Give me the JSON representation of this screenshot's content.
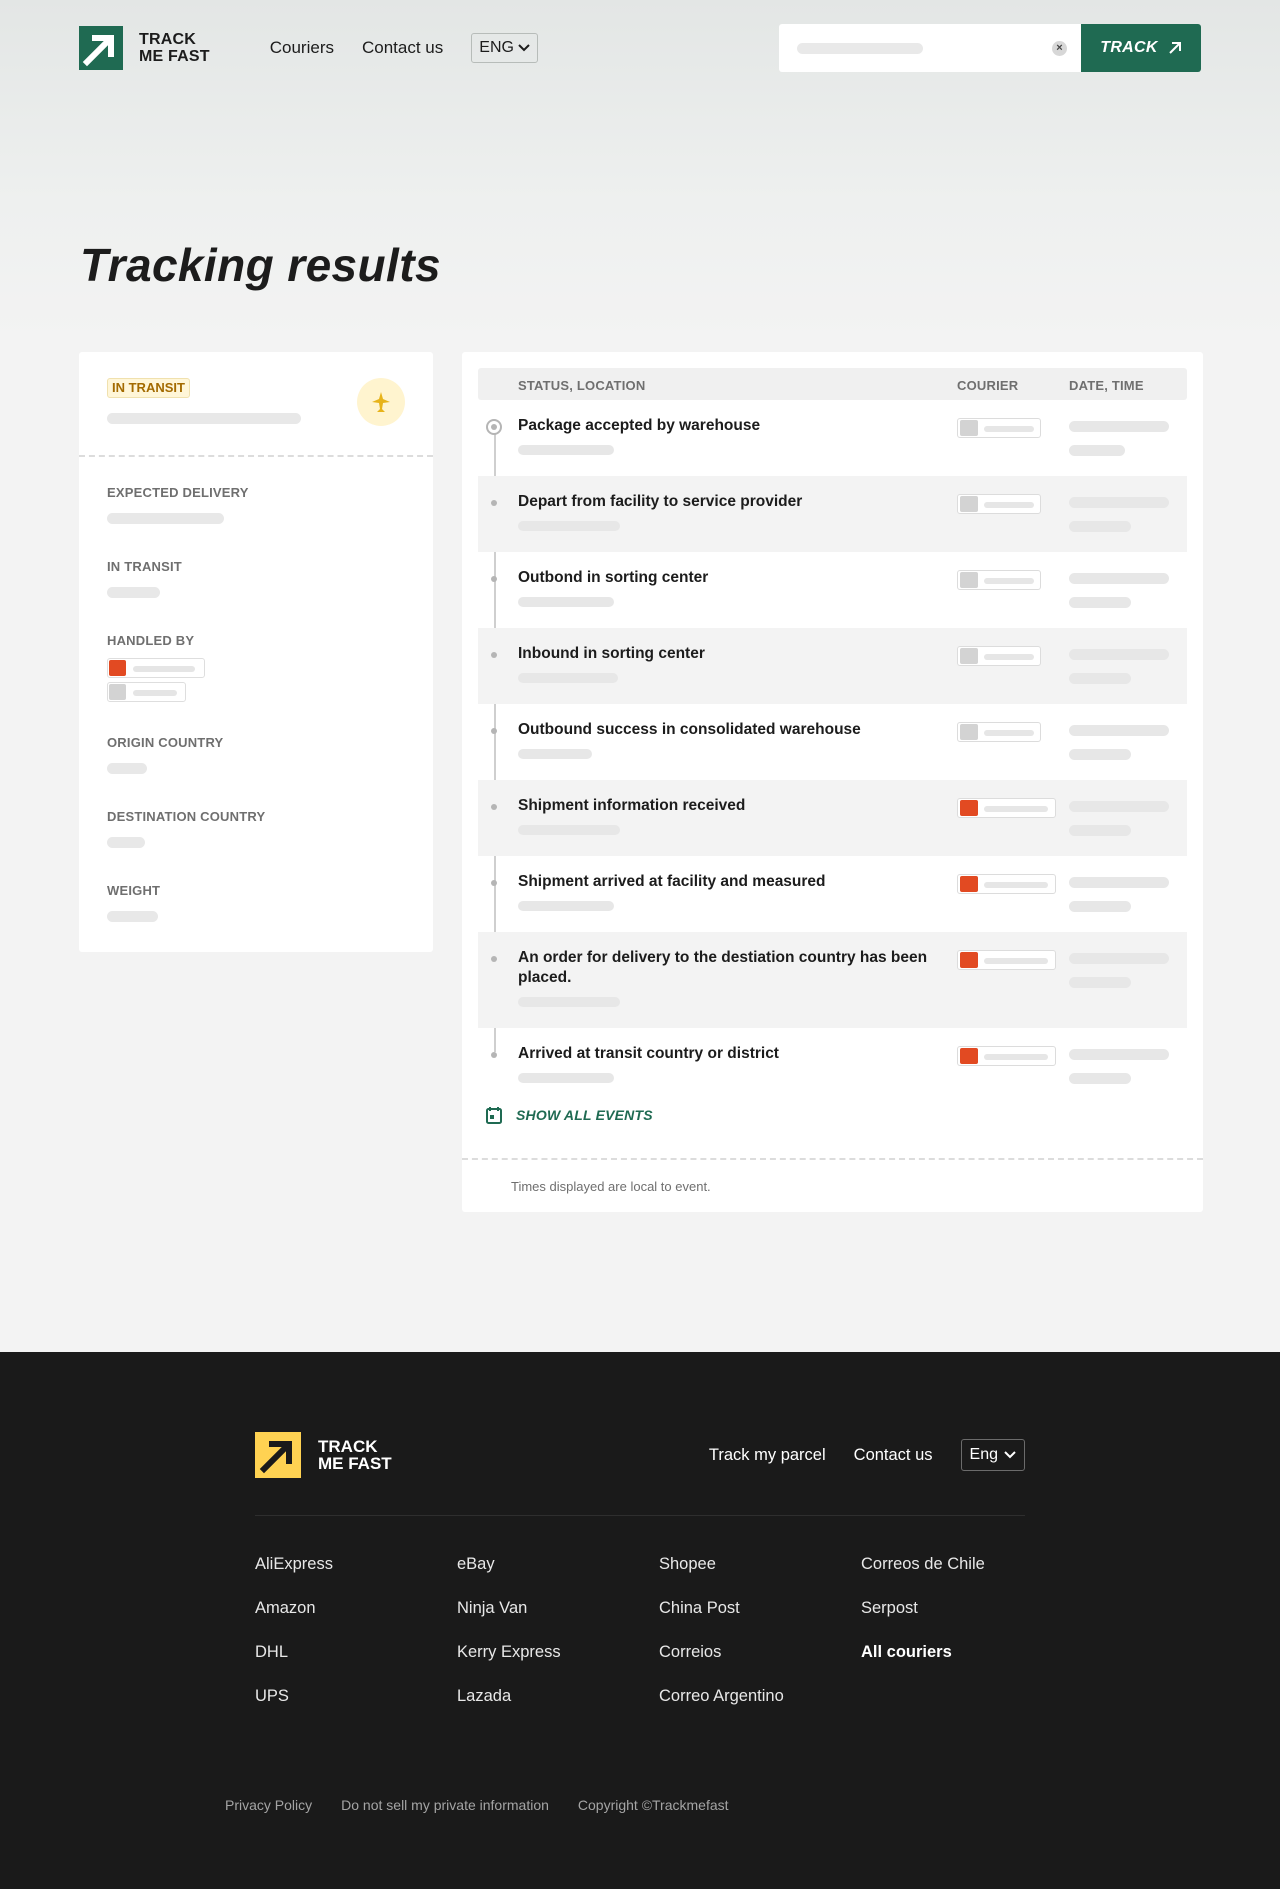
{
  "header": {
    "logo_line1": "TRACK",
    "logo_line2": "ME FAST",
    "nav": [
      "Couriers",
      "Contact us"
    ],
    "lang": "ENG",
    "track_button": "TRACK"
  },
  "page_title": "Tracking results",
  "summary": {
    "status_badge": "IN TRANSIT",
    "fields": [
      "EXPECTED DELIVERY",
      "IN TRANSIT",
      "HANDLED BY",
      "ORIGIN COUNTRY",
      "DESTINATION COUNTRY",
      "WEIGHT"
    ]
  },
  "events_table": {
    "columns": [
      "STATUS, LOCATION",
      "COURIER",
      "DATE, TIME"
    ],
    "rows": [
      {
        "status": "Package accepted by warehouse",
        "courier": "truck"
      },
      {
        "status": "Depart from facility to service provider",
        "courier": "truck"
      },
      {
        "status": "Outbond in sorting center",
        "courier": "truck"
      },
      {
        "status": "Inbound in sorting center",
        "courier": "truck"
      },
      {
        "status": "Outbound success in consolidated warehouse",
        "courier": "truck"
      },
      {
        "status": "Shipment information received",
        "courier": "red-heart"
      },
      {
        "status": "Shipment arrived at facility and measured",
        "courier": "red-heart"
      },
      {
        "status": "An order for delivery to the destiation country has been placed.",
        "courier": "red-heart"
      },
      {
        "status": "Arrived at transit country or district",
        "courier": "red-heart"
      }
    ],
    "show_all": "SHOW ALL EVENTS",
    "note": "Times displayed are local to event."
  },
  "footer": {
    "logo_line1": "TRACK",
    "logo_line2": "ME FAST",
    "nav": [
      "Track my parcel",
      "Contact us"
    ],
    "lang": "Eng",
    "columns": [
      [
        "AliExpress",
        "Amazon",
        "DHL",
        "UPS"
      ],
      [
        "eBay",
        "Ninja Van",
        "Kerry Express",
        "Lazada"
      ],
      [
        "Shopee",
        "China Post",
        "Correios",
        "Correo Argentino"
      ],
      [
        "Correos de Chile",
        "Serpost",
        "All couriers"
      ]
    ],
    "bottom_links": [
      "Privacy Policy",
      "Do not sell my private information",
      "Copyright ©Trackmefast"
    ]
  },
  "colors": {
    "brand_green": "#1f6a52",
    "brand_yellow": "#ffd252",
    "courier_red": "#e24a22"
  },
  "icons": {
    "logo": "arrow-up-right-icon",
    "status": "plane-icon",
    "calendar": "calendar-icon",
    "courier_generic": "truck-icon",
    "courier_red": "heart-icon"
  }
}
